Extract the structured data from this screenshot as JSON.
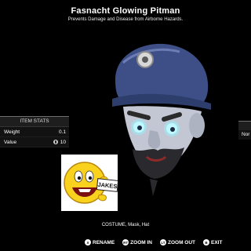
{
  "item": {
    "title": "Fasnacht Glowing Pitman",
    "description": "Prevents Damage and Disease from Airborne Hazards.",
    "categories": "COSTUME, Mask, Hat"
  },
  "stats_panel": {
    "title": "ITEM STATS",
    "rows": [
      {
        "label": "Weight",
        "value": "0.1"
      },
      {
        "label": "Value",
        "value": "10",
        "icon": "caps-icon"
      }
    ]
  },
  "right_panel": {
    "row_text": "Nor"
  },
  "overlay": {
    "emoji_text": "JAKES"
  },
  "hints": [
    {
      "button": "X",
      "label": "RENAME"
    },
    {
      "button": "RT",
      "label": "ZOOM IN"
    },
    {
      "button": "LT",
      "label": "ZOOM OUT"
    },
    {
      "button": "B",
      "label": "EXIT"
    }
  ],
  "colors": {
    "background": "#000000",
    "panel": "#1e1e1e",
    "mask_blue": "#4a5f9a",
    "eye_glow": "#8ff5ff"
  }
}
